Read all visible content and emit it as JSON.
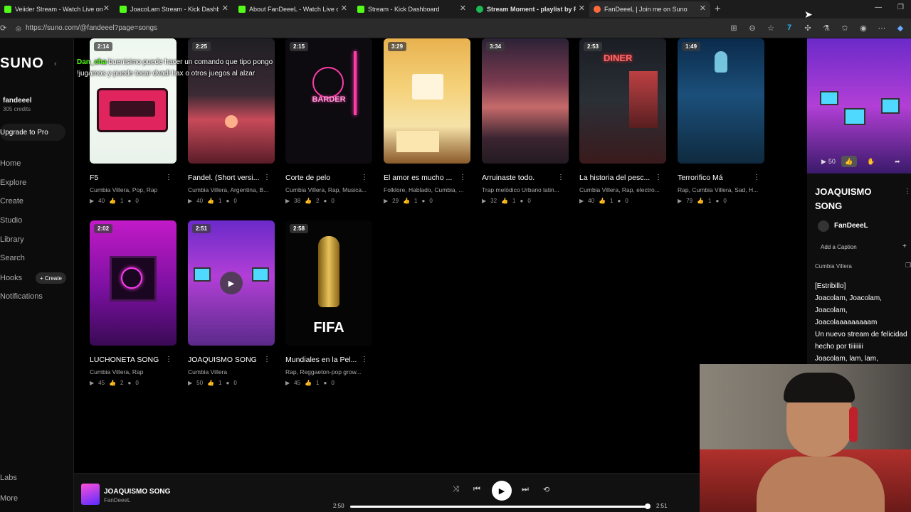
{
  "browser": {
    "tabs": [
      {
        "title": "Veiider Stream - Watch Live on Kic",
        "icon_color": "#53fc18"
      },
      {
        "title": "JoacoLam Stream - Kick Dashb",
        "icon_color": "#53fc18"
      },
      {
        "title": "About FanDeeeL - Watch Live on K",
        "icon_color": "#53fc18"
      },
      {
        "title": "Stream - Kick Dashboard",
        "icon_color": "#53fc18"
      },
      {
        "title": "Stream Moment - playlist by Fan",
        "icon_color": "#1db954"
      },
      {
        "title": "FanDeeeL | Join me on Suno",
        "icon_color": "#ff6a3d"
      }
    ],
    "url": "https://suno.com/@fandeeel?page=songs"
  },
  "sidebar": {
    "logo": "SUNO",
    "username": "fandeeel",
    "credits": "305 credits",
    "upgrade_label": "Upgrade to Pro",
    "nav": [
      "Home",
      "Explore",
      "Create",
      "Studio",
      "Library",
      "Search",
      "Hooks",
      "Notifications"
    ],
    "hooks_create": "+ Create",
    "bottom": [
      "Labs",
      "More"
    ]
  },
  "chat": {
    "user": "Dan_cha",
    "message": "buenisimo puede hacer un comando que tipo pongo !jugamos y puede tocar dvadi hax o otros juegos al alzar"
  },
  "cards": [
    {
      "duration": "2:14",
      "title": "F5",
      "tags": "Cumbia Villera, Pop, Rap",
      "plays": "40",
      "likes": "1",
      "comments": "0"
    },
    {
      "duration": "2:25",
      "title": "Fandel. (Short versi...",
      "tags": "Cumbia Villera, Argentina, B...",
      "plays": "40",
      "likes": "1",
      "comments": "0"
    },
    {
      "duration": "2:15",
      "title": "Corte de pelo",
      "tags": "Cumbia Villera, Rap, Musica...",
      "plays": "38",
      "likes": "2",
      "comments": "0",
      "overlay_text": "BARDER"
    },
    {
      "duration": "3:29",
      "title": "El amor es mucho ...",
      "tags": "Folklore, Hablado, Cumbia, ...",
      "plays": "29",
      "likes": "1",
      "comments": "0"
    },
    {
      "duration": "3:34",
      "title": "Arruinaste todo.",
      "tags": "Trap melódico Urbano latin...",
      "plays": "32",
      "likes": "1",
      "comments": "0"
    },
    {
      "duration": "2:53",
      "title": "La historia del pesc...",
      "tags": "Cumbia Villera, Rap, electro...",
      "plays": "40",
      "likes": "1",
      "comments": "0",
      "overlay_text": "DINER"
    },
    {
      "duration": "1:49",
      "title": "Terrorifico Má",
      "tags": "Rap, Cumbia Villera, Sad, H...",
      "plays": "79",
      "likes": "1",
      "comments": "0"
    },
    {
      "duration": "2:02",
      "title": "LUCHONETA SONG",
      "tags": "Cumbia Villera, Rap",
      "plays": "45",
      "likes": "2",
      "comments": "0"
    },
    {
      "duration": "2:51",
      "title": "JOAQUISMO SONG",
      "tags": "Cumbia Villera",
      "plays": "50",
      "likes": "1",
      "comments": "0"
    },
    {
      "duration": "2:58",
      "title": "Mundiales en la Pel...",
      "tags": "Rap, Reggaeton-pop grow...",
      "plays": "45",
      "likes": "1",
      "comments": "0",
      "overlay_text": "FIFA"
    }
  ],
  "right_panel": {
    "plays": "50",
    "title": "JOAQUISMO SONG",
    "artist": "FanDeeeL",
    "add_caption": "Add a Caption",
    "style": "Cumbia Villera",
    "lyrics": [
      "[Estribillo]",
      "Joacolam, Joacolam,",
      "Joacolam,",
      "Joacolaaaaaaaaam",
      "Un nuevo stream de felicidad",
      "hecho por tiiiiiiii",
      "Joacolam, lam, lam,"
    ]
  },
  "player": {
    "title": "JOAQUISMO SONG",
    "artist": "FanDeeeL",
    "current_time": "2:50",
    "total_time": "2:51",
    "progress": 0.99
  }
}
